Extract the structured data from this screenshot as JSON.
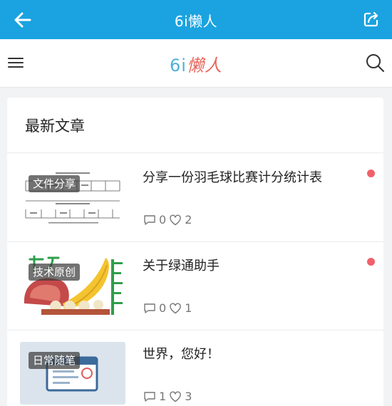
{
  "appbar": {
    "title": "6i懒人",
    "back_icon": "arrow-left-icon",
    "share_icon": "share-icon",
    "color": "#1aa3e0"
  },
  "site": {
    "logo_part1": "6i",
    "logo_part2": "懒人",
    "menu_icon": "hamburger-menu-icon",
    "search_icon": "search-icon"
  },
  "section": {
    "heading": "最新文章"
  },
  "articles": [
    {
      "category": "文件分享",
      "title": "分享一份羽毛球比赛计分统计表",
      "comments": "0",
      "likes": "2",
      "unread": true
    },
    {
      "category": "技术原创",
      "title": "关于绿通助手",
      "comments": "0",
      "likes": "1",
      "unread": true
    },
    {
      "category": "日常随笔",
      "title": "世界，您好！",
      "comments": "1",
      "likes": "3",
      "unread": false
    }
  ]
}
